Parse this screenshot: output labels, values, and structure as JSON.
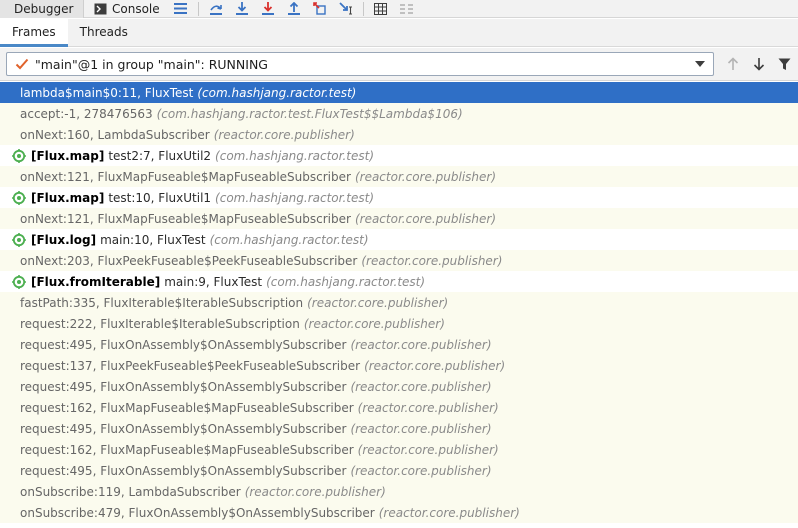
{
  "toolbar": {
    "debugger_label": "Debugger",
    "console_label": "Console",
    "icons": [
      "layout-icon",
      "step-over-icon",
      "step-into-icon",
      "force-step-into-icon",
      "step-out-icon",
      "drop-frame-icon",
      "run-to-cursor-icon",
      "evaluate-icon",
      "trace-icon"
    ]
  },
  "subtabs": {
    "frames_label": "Frames",
    "threads_label": "Threads"
  },
  "thread": {
    "selected": "\"main\"@1 in group \"main\": RUNNING"
  },
  "frames": [
    {
      "kind": "sel",
      "text": "lambda$main$0:11, FluxTest",
      "pkg": "(com.hashjang.ractor.test)"
    },
    {
      "kind": "lib",
      "text": "accept:-1, 278476563",
      "pkg": "(com.hashjang.ractor.test.FluxTest$$Lambda$106)"
    },
    {
      "kind": "lib",
      "text": "onNext:160, LambdaSubscriber",
      "pkg": "(reactor.core.publisher)"
    },
    {
      "kind": "async",
      "badge": "[Flux.map]",
      "text": "test2:7, FluxUtil2",
      "pkg": "(com.hashjang.ractor.test)"
    },
    {
      "kind": "lib",
      "text": "onNext:121, FluxMapFuseable$MapFuseableSubscriber",
      "pkg": "(reactor.core.publisher)"
    },
    {
      "kind": "async",
      "badge": "[Flux.map]",
      "text": "test:10, FluxUtil1",
      "pkg": "(com.hashjang.ractor.test)"
    },
    {
      "kind": "lib",
      "text": "onNext:121, FluxMapFuseable$MapFuseableSubscriber",
      "pkg": "(reactor.core.publisher)"
    },
    {
      "kind": "async",
      "badge": "[Flux.log]",
      "text": "main:10, FluxTest",
      "pkg": "(com.hashjang.ractor.test)"
    },
    {
      "kind": "lib",
      "text": "onNext:203, FluxPeekFuseable$PeekFuseableSubscriber",
      "pkg": "(reactor.core.publisher)"
    },
    {
      "kind": "async",
      "badge": "[Flux.fromIterable]",
      "text": "main:9, FluxTest",
      "pkg": "(com.hashjang.ractor.test)"
    },
    {
      "kind": "lib",
      "text": "fastPath:335, FluxIterable$IterableSubscription",
      "pkg": "(reactor.core.publisher)"
    },
    {
      "kind": "lib",
      "text": "request:222, FluxIterable$IterableSubscription",
      "pkg": "(reactor.core.publisher)"
    },
    {
      "kind": "lib",
      "text": "request:495, FluxOnAssembly$OnAssemblySubscriber",
      "pkg": "(reactor.core.publisher)"
    },
    {
      "kind": "lib",
      "text": "request:137, FluxPeekFuseable$PeekFuseableSubscriber",
      "pkg": "(reactor.core.publisher)"
    },
    {
      "kind": "lib",
      "text": "request:495, FluxOnAssembly$OnAssemblySubscriber",
      "pkg": "(reactor.core.publisher)"
    },
    {
      "kind": "lib",
      "text": "request:162, FluxMapFuseable$MapFuseableSubscriber",
      "pkg": "(reactor.core.publisher)"
    },
    {
      "kind": "lib",
      "text": "request:495, FluxOnAssembly$OnAssemblySubscriber",
      "pkg": "(reactor.core.publisher)"
    },
    {
      "kind": "lib",
      "text": "request:162, FluxMapFuseable$MapFuseableSubscriber",
      "pkg": "(reactor.core.publisher)"
    },
    {
      "kind": "lib",
      "text": "request:495, FluxOnAssembly$OnAssemblySubscriber",
      "pkg": "(reactor.core.publisher)"
    },
    {
      "kind": "lib",
      "text": "onSubscribe:119, LambdaSubscriber",
      "pkg": "(reactor.core.publisher)"
    },
    {
      "kind": "lib",
      "text": "onSubscribe:479, FluxOnAssembly$OnAssemblySubscriber",
      "pkg": "(reactor.core.publisher)"
    }
  ],
  "colors": {
    "selection": "#2f6fc6",
    "library_row": "#fbfbee",
    "tab_underline": "#4a88c7",
    "async_icon": "#4caf50"
  }
}
